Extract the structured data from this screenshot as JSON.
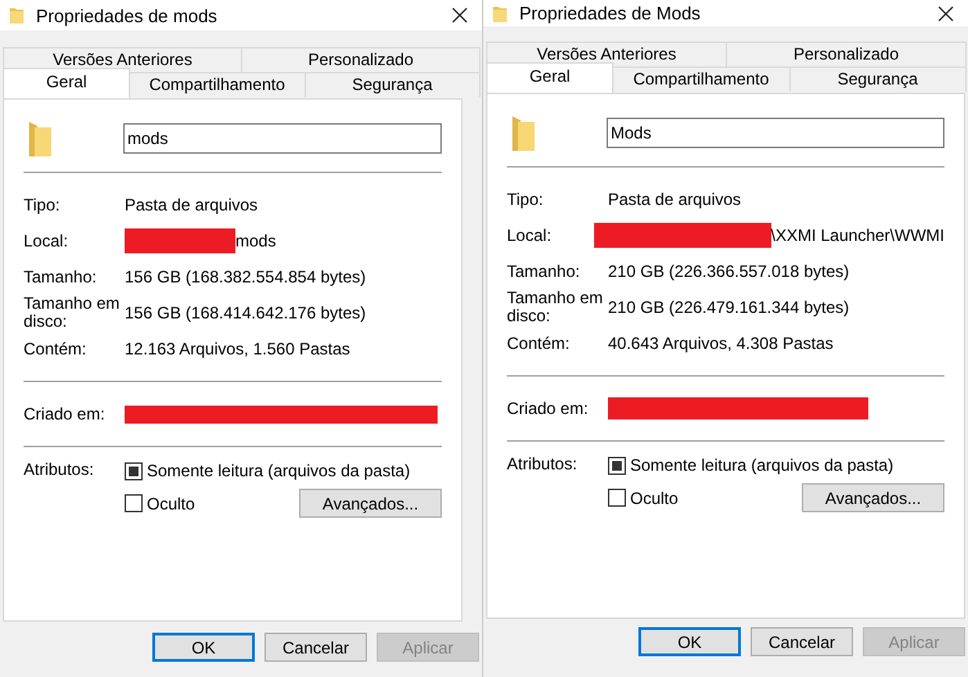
{
  "dialogs": [
    {
      "title": "Propriedades de mods",
      "tab_rows": [
        [
          {
            "label": "Versões Anteriores",
            "selected": false
          },
          {
            "label": "Personalizado",
            "selected": false
          }
        ],
        [
          {
            "label": "Geral",
            "selected": true
          },
          {
            "label": "Compartilhamento",
            "selected": false
          },
          {
            "label": "Segurança",
            "selected": false
          }
        ]
      ],
      "name_field": {
        "value": "mods"
      },
      "info": [
        {
          "label": "Tipo:",
          "value": "Pasta de arquivos",
          "redacted": false
        },
        {
          "label": "Local:",
          "value": "mods",
          "redacted": true
        },
        {
          "label": "Tamanho:",
          "value": "156 GB (168.382.554.854 bytes)",
          "redacted": false
        },
        {
          "label": "Tamanho em disco:",
          "value": "156 GB (168.414.642.176 bytes)",
          "redacted": false
        },
        {
          "label": "Contém:",
          "value": "12.163 Arquivos, 1.560 Pastas",
          "redacted": false
        }
      ],
      "created": {
        "label": "Criado em:",
        "redacted": true
      },
      "attributes": {
        "label": "Atributos:",
        "checkboxes": [
          {
            "label": "Somente leitura (arquivos da pasta)",
            "checked": true
          },
          {
            "label": "Oculto",
            "checked": false
          }
        ],
        "advanced_button": "Avançados..."
      },
      "buttons": [
        {
          "label": "OK",
          "default": true,
          "disabled": false
        },
        {
          "label": "Cancelar",
          "default": false,
          "disabled": false
        },
        {
          "label": "Aplicar",
          "default": false,
          "disabled": true
        }
      ]
    },
    {
      "title": "Propriedades de Mods",
      "tab_rows": [
        [
          {
            "label": "Versões Anteriores",
            "selected": false
          },
          {
            "label": "Personalizado",
            "selected": false
          }
        ],
        [
          {
            "label": "Geral",
            "selected": true
          },
          {
            "label": "Compartilhamento",
            "selected": false
          },
          {
            "label": "Segurança",
            "selected": false
          }
        ]
      ],
      "name_field": {
        "value": "Mods"
      },
      "info": [
        {
          "label": "Tipo:",
          "value": "Pasta de arquivos",
          "redacted": false
        },
        {
          "label": "Local:",
          "value": "\\XXMI Launcher\\WWMI",
          "redacted": true
        },
        {
          "label": "Tamanho:",
          "value": "210 GB (226.366.557.018 bytes)",
          "redacted": false
        },
        {
          "label": "Tamanho em disco:",
          "value": "210 GB (226.479.161.344 bytes)",
          "redacted": false
        },
        {
          "label": "Contém:",
          "value": "40.643 Arquivos, 4.308 Pastas",
          "redacted": false
        }
      ],
      "created": {
        "label": "Criado em:",
        "redacted": true
      },
      "attributes": {
        "label": "Atributos:",
        "checkboxes": [
          {
            "label": "Somente leitura (arquivos da pasta)",
            "checked": true
          },
          {
            "label": "Oculto",
            "checked": false
          }
        ],
        "advanced_button": "Avançados..."
      },
      "buttons": [
        {
          "label": "OK",
          "default": true,
          "disabled": false
        },
        {
          "label": "Cancelar",
          "default": false,
          "disabled": false
        },
        {
          "label": "Aplicar",
          "default": false,
          "disabled": true
        }
      ]
    }
  ]
}
